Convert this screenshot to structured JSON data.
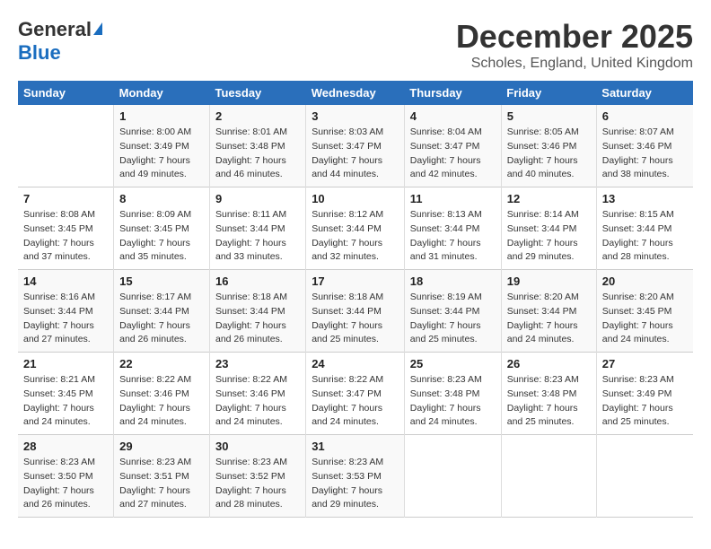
{
  "logo": {
    "general": "General",
    "blue": "Blue"
  },
  "title": "December 2025",
  "location": "Scholes, England, United Kingdom",
  "days_of_week": [
    "Sunday",
    "Monday",
    "Tuesday",
    "Wednesday",
    "Thursday",
    "Friday",
    "Saturday"
  ],
  "weeks": [
    [
      {
        "day": "",
        "info": ""
      },
      {
        "day": "1",
        "info": "Sunrise: 8:00 AM\nSunset: 3:49 PM\nDaylight: 7 hours\nand 49 minutes."
      },
      {
        "day": "2",
        "info": "Sunrise: 8:01 AM\nSunset: 3:48 PM\nDaylight: 7 hours\nand 46 minutes."
      },
      {
        "day": "3",
        "info": "Sunrise: 8:03 AM\nSunset: 3:47 PM\nDaylight: 7 hours\nand 44 minutes."
      },
      {
        "day": "4",
        "info": "Sunrise: 8:04 AM\nSunset: 3:47 PM\nDaylight: 7 hours\nand 42 minutes."
      },
      {
        "day": "5",
        "info": "Sunrise: 8:05 AM\nSunset: 3:46 PM\nDaylight: 7 hours\nand 40 minutes."
      },
      {
        "day": "6",
        "info": "Sunrise: 8:07 AM\nSunset: 3:46 PM\nDaylight: 7 hours\nand 38 minutes."
      }
    ],
    [
      {
        "day": "7",
        "info": "Sunrise: 8:08 AM\nSunset: 3:45 PM\nDaylight: 7 hours\nand 37 minutes."
      },
      {
        "day": "8",
        "info": "Sunrise: 8:09 AM\nSunset: 3:45 PM\nDaylight: 7 hours\nand 35 minutes."
      },
      {
        "day": "9",
        "info": "Sunrise: 8:11 AM\nSunset: 3:44 PM\nDaylight: 7 hours\nand 33 minutes."
      },
      {
        "day": "10",
        "info": "Sunrise: 8:12 AM\nSunset: 3:44 PM\nDaylight: 7 hours\nand 32 minutes."
      },
      {
        "day": "11",
        "info": "Sunrise: 8:13 AM\nSunset: 3:44 PM\nDaylight: 7 hours\nand 31 minutes."
      },
      {
        "day": "12",
        "info": "Sunrise: 8:14 AM\nSunset: 3:44 PM\nDaylight: 7 hours\nand 29 minutes."
      },
      {
        "day": "13",
        "info": "Sunrise: 8:15 AM\nSunset: 3:44 PM\nDaylight: 7 hours\nand 28 minutes."
      }
    ],
    [
      {
        "day": "14",
        "info": "Sunrise: 8:16 AM\nSunset: 3:44 PM\nDaylight: 7 hours\nand 27 minutes."
      },
      {
        "day": "15",
        "info": "Sunrise: 8:17 AM\nSunset: 3:44 PM\nDaylight: 7 hours\nand 26 minutes."
      },
      {
        "day": "16",
        "info": "Sunrise: 8:18 AM\nSunset: 3:44 PM\nDaylight: 7 hours\nand 26 minutes."
      },
      {
        "day": "17",
        "info": "Sunrise: 8:18 AM\nSunset: 3:44 PM\nDaylight: 7 hours\nand 25 minutes."
      },
      {
        "day": "18",
        "info": "Sunrise: 8:19 AM\nSunset: 3:44 PM\nDaylight: 7 hours\nand 25 minutes."
      },
      {
        "day": "19",
        "info": "Sunrise: 8:20 AM\nSunset: 3:44 PM\nDaylight: 7 hours\nand 24 minutes."
      },
      {
        "day": "20",
        "info": "Sunrise: 8:20 AM\nSunset: 3:45 PM\nDaylight: 7 hours\nand 24 minutes."
      }
    ],
    [
      {
        "day": "21",
        "info": "Sunrise: 8:21 AM\nSunset: 3:45 PM\nDaylight: 7 hours\nand 24 minutes."
      },
      {
        "day": "22",
        "info": "Sunrise: 8:22 AM\nSunset: 3:46 PM\nDaylight: 7 hours\nand 24 minutes."
      },
      {
        "day": "23",
        "info": "Sunrise: 8:22 AM\nSunset: 3:46 PM\nDaylight: 7 hours\nand 24 minutes."
      },
      {
        "day": "24",
        "info": "Sunrise: 8:22 AM\nSunset: 3:47 PM\nDaylight: 7 hours\nand 24 minutes."
      },
      {
        "day": "25",
        "info": "Sunrise: 8:23 AM\nSunset: 3:48 PM\nDaylight: 7 hours\nand 24 minutes."
      },
      {
        "day": "26",
        "info": "Sunrise: 8:23 AM\nSunset: 3:48 PM\nDaylight: 7 hours\nand 25 minutes."
      },
      {
        "day": "27",
        "info": "Sunrise: 8:23 AM\nSunset: 3:49 PM\nDaylight: 7 hours\nand 25 minutes."
      }
    ],
    [
      {
        "day": "28",
        "info": "Sunrise: 8:23 AM\nSunset: 3:50 PM\nDaylight: 7 hours\nand 26 minutes."
      },
      {
        "day": "29",
        "info": "Sunrise: 8:23 AM\nSunset: 3:51 PM\nDaylight: 7 hours\nand 27 minutes."
      },
      {
        "day": "30",
        "info": "Sunrise: 8:23 AM\nSunset: 3:52 PM\nDaylight: 7 hours\nand 28 minutes."
      },
      {
        "day": "31",
        "info": "Sunrise: 8:23 AM\nSunset: 3:53 PM\nDaylight: 7 hours\nand 29 minutes."
      },
      {
        "day": "",
        "info": ""
      },
      {
        "day": "",
        "info": ""
      },
      {
        "day": "",
        "info": ""
      }
    ]
  ]
}
